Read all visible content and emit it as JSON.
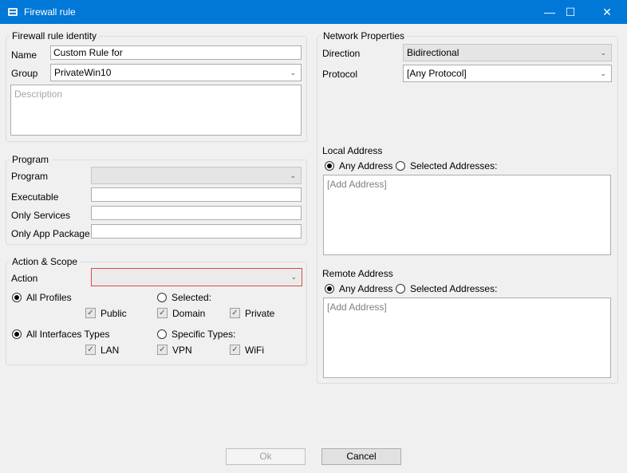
{
  "window": {
    "title": "Firewall rule",
    "accent": "#0078d7",
    "minimize": "—",
    "maximize": "☐",
    "close": "✕"
  },
  "identity": {
    "legend": "Firewall rule identity",
    "name_label": "Name",
    "name_value": "Custom Rule for",
    "group_label": "Group",
    "group_value": "PrivateWin10",
    "description_placeholder": "Description"
  },
  "program": {
    "legend": "Program",
    "program_label": "Program",
    "program_value": "",
    "executable_label": "Executable",
    "executable_value": "",
    "services_label": "Only Services",
    "services_value": "",
    "package_label": "Only App Package",
    "package_value": ""
  },
  "action_scope": {
    "legend": "Action & Scope",
    "action_label": "Action",
    "action_value": "",
    "all_profiles": "All Profiles",
    "selected": "Selected:",
    "public": "Public",
    "domain": "Domain",
    "private": "Private",
    "all_interfaces": "All Interfaces Types",
    "specific_types": "Specific Types:",
    "lan": "LAN",
    "vpn": "VPN",
    "wifi": "WiFi"
  },
  "network": {
    "legend": "Network Properties",
    "direction_label": "Direction",
    "direction_value": "Bidirectional",
    "protocol_label": "Protocol",
    "protocol_value": "[Any Protocol]",
    "local_title": "Local Address",
    "local_any": "Any Address",
    "local_selected": "Selected Addresses:",
    "local_add": "[Add Address]",
    "remote_title": "Remote Address",
    "remote_any": "Any Address",
    "remote_selected": "Selected Addresses:",
    "remote_add": "[Add Address]"
  },
  "buttons": {
    "ok": "Ok",
    "cancel": "Cancel"
  }
}
